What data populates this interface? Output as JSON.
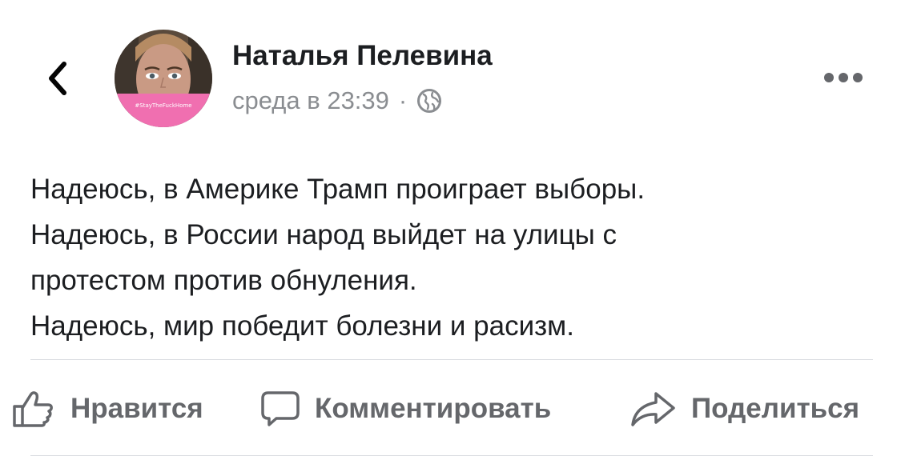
{
  "header": {
    "back_icon": "chevron-left-icon",
    "more_icon": "more-horizontal-icon"
  },
  "author": {
    "name": "Наталья Пелевина",
    "avatar_tag": "#StayTheFuckHome"
  },
  "post_meta": {
    "timestamp": "среда в 23:39",
    "separator": "·",
    "privacy_icon": "globe-icon"
  },
  "post": {
    "lines": [
      "Надеюсь, в Америке Трамп проиграет выборы.",
      "Надеюсь, в России народ выйдет на улицы с",
      "протестом против обнуления.",
      "Надеюсь, мир победит болезни и расизм."
    ]
  },
  "actions": {
    "like_label": "Нравится",
    "comment_label": "Комментировать",
    "share_label": "Поделиться"
  },
  "colors": {
    "text_primary": "#1c1e21",
    "text_secondary": "#8a8d91",
    "action_text": "#65676b",
    "divider": "#dadde1",
    "avatar_banner": "#f06fb0"
  }
}
